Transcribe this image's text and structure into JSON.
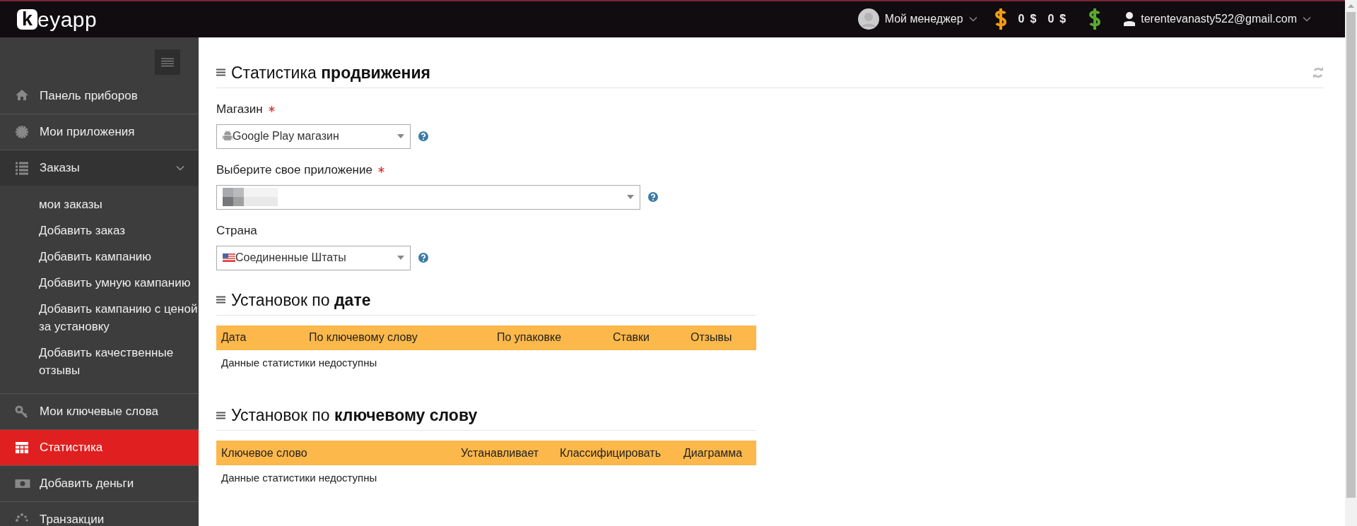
{
  "header": {
    "logo": {
      "mark": "k",
      "text": "eyapp"
    },
    "manager": {
      "label": "Мой менеджер"
    },
    "balances": [
      {
        "amount": "0",
        "currency": "$"
      },
      {
        "amount": "0",
        "currency": "$"
      }
    ],
    "user": {
      "email": "terentevanasty522@gmail.com"
    }
  },
  "sidebar": {
    "items": [
      {
        "label": "Панель приборов",
        "selected": false
      },
      {
        "label": "Мои приложения",
        "selected": false
      },
      {
        "label": "Заказы",
        "selected": false,
        "expanded": true,
        "children": [
          {
            "label": "мои заказы"
          },
          {
            "label": "Добавить заказ"
          },
          {
            "label": "Добавить кампанию"
          },
          {
            "label": "Добавить умную кампанию"
          },
          {
            "label": "Добавить кампанию с ценой за установку"
          },
          {
            "label": "Добавить качественные отзывы"
          }
        ]
      },
      {
        "label": "Мои ключевые слова",
        "selected": false
      },
      {
        "label": "Статистика",
        "selected": true
      },
      {
        "label": "Добавить деньги",
        "selected": false
      },
      {
        "label": "Транзакции",
        "selected": false
      }
    ]
  },
  "promotion": {
    "title": "Статистика **продвижения**",
    "fields": [
      {
        "label": "Магазин",
        "required": true,
        "kind": "store",
        "value": "Google Play магазин"
      },
      {
        "label": "Выберите свое приложение",
        "required": true,
        "kind": "hidden"
      },
      {
        "label": "Страна",
        "kind": "country",
        "value": "Соединенные Штаты"
      }
    ]
  },
  "tables": [
    {
      "title": "Установок по **дате**",
      "columns": [
        "Дата",
        "По ключевому слову",
        "По упаковке",
        "Ставки",
        "Отзывы"
      ],
      "empty_text": "Данные статистики недоступны"
    },
    {
      "title": "Установок по **ключевому слову**",
      "columns": [
        "Ключевое слово",
        "Устанавливает",
        "Классифицировать",
        "Диаграмма"
      ],
      "empty_text": "Данные статистики недоступны"
    }
  ]
}
